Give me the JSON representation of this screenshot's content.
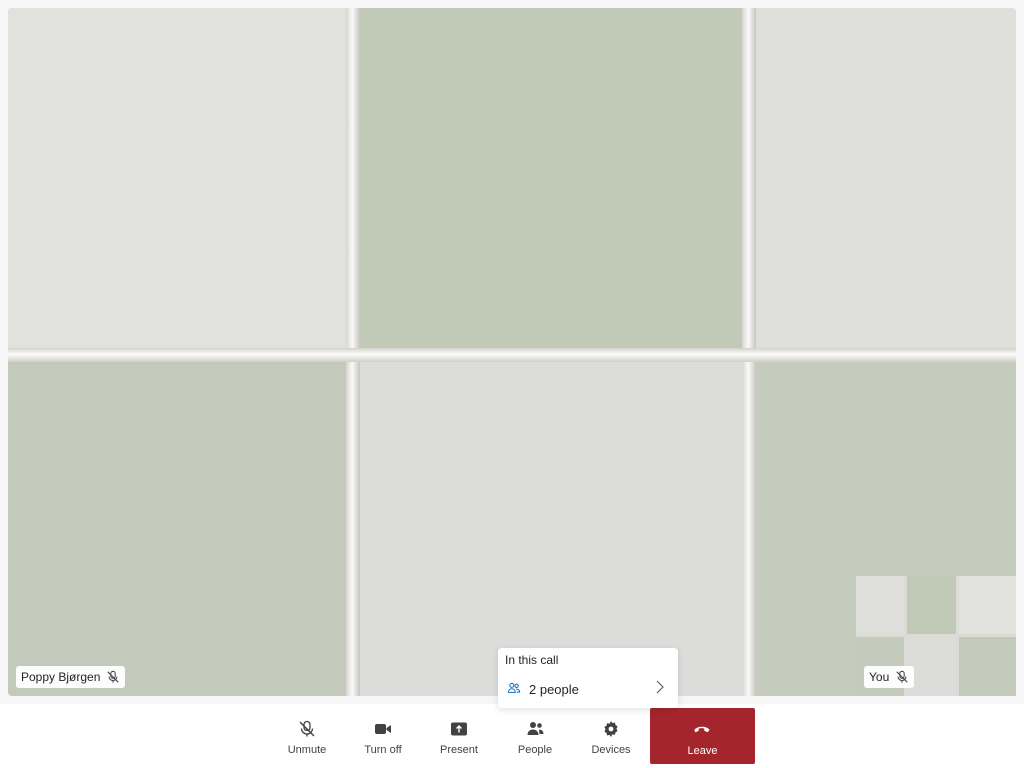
{
  "remote": {
    "name": "Poppy Bjørgen",
    "mic_icon": "mic-off-icon"
  },
  "self_view": {
    "name": "You",
    "mic_icon": "mic-off-icon"
  },
  "in_call_popup": {
    "title": "In this call",
    "count": "2 people",
    "icon": "people-icon",
    "chevron": "chevron-right-icon"
  },
  "toolbar": {
    "unmute": {
      "label": "Unmute",
      "icon": "mic-off-icon"
    },
    "camera": {
      "label": "Turn off",
      "icon": "camera-icon"
    },
    "present": {
      "label": "Present",
      "icon": "share-screen-icon"
    },
    "people": {
      "label": "People",
      "icon": "people-icon"
    },
    "devices": {
      "label": "Devices",
      "icon": "gear-icon"
    },
    "leave": {
      "label": "Leave",
      "icon": "hang-up-icon"
    }
  },
  "colors": {
    "leave_bg": "#a4262c",
    "accent": "#0f6cbd",
    "tile_green": "#c2c9b8",
    "tile_light": "#e0e1dc"
  }
}
